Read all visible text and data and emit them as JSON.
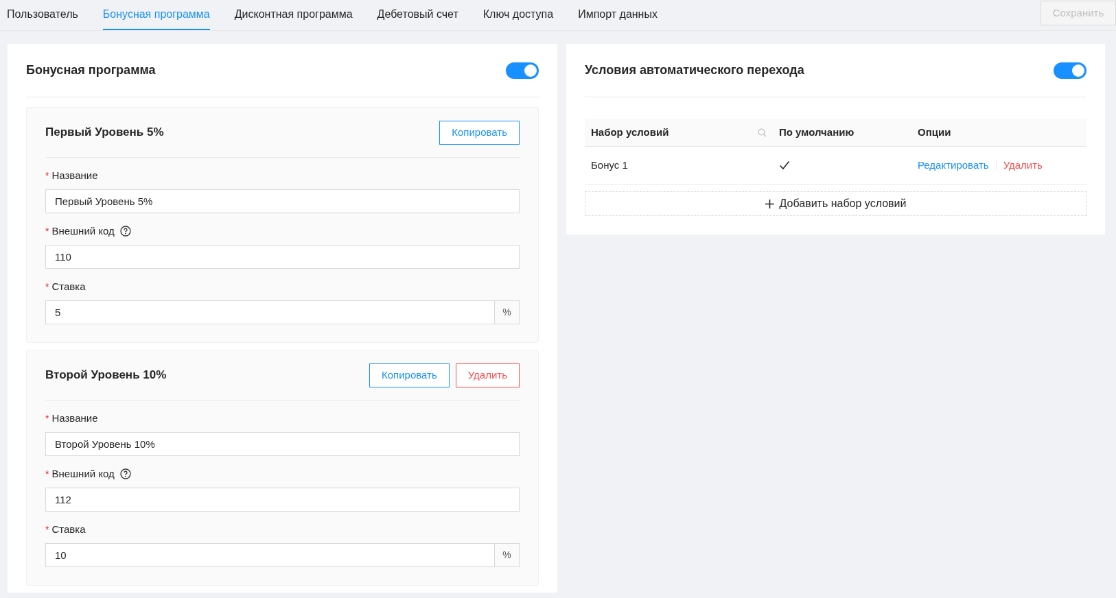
{
  "tabs": [
    {
      "label": "Пользователь",
      "selected": false
    },
    {
      "label": "Бонусная программа",
      "selected": true
    },
    {
      "label": "Дисконтная программа",
      "selected": false
    },
    {
      "label": "Дебетовый счет",
      "selected": false
    },
    {
      "label": "Ключ доступа",
      "selected": false
    },
    {
      "label": "Импорт данных",
      "selected": false
    }
  ],
  "save_button": {
    "label": "Сохранить",
    "disabled": true
  },
  "bonus_panel": {
    "title": "Бонусная программа",
    "on": true,
    "levels": [
      {
        "title": "Первый Уровень 5%",
        "buttons": [
          {
            "kind": "copy",
            "label": "Копировать"
          }
        ],
        "fields": [
          {
            "mark": "*",
            "label": "Название",
            "value": "Первый Уровень 5%",
            "help": false
          },
          {
            "mark": "*",
            "label": "Внешний код",
            "value": "110",
            "help": true
          },
          {
            "mark": "*",
            "label": "Ставка",
            "value": "5",
            "suffix": "%",
            "help": false
          }
        ]
      },
      {
        "title": "Второй Уровень 10%",
        "buttons": [
          {
            "kind": "copy",
            "label": "Копировать"
          },
          {
            "kind": "delete",
            "label": "Удалить"
          }
        ],
        "fields": [
          {
            "mark": "*",
            "label": "Название",
            "value": "Второй Уровень 10%",
            "help": false
          },
          {
            "mark": "*",
            "label": "Внешний код",
            "value": "112",
            "help": true
          },
          {
            "mark": "*",
            "label": "Ставка",
            "value": "10",
            "suffix": "%",
            "help": false
          }
        ]
      }
    ]
  },
  "transition_panel": {
    "title": "Условия автоматического перехода",
    "on": true,
    "table": {
      "columns": [
        {
          "label": "Набор условий",
          "searchable": true
        },
        {
          "label": "По умолчанию",
          "searchable": false
        },
        {
          "label": "Опции",
          "searchable": false
        }
      ],
      "rows": [
        {
          "name": "Бонус 1",
          "default": true,
          "actions": [
            {
              "kind": "edit",
              "label": "Редактировать"
            },
            {
              "kind": "delete",
              "label": "Удалить"
            }
          ]
        }
      ]
    },
    "add_button": {
      "label": "Добавить набор условий"
    }
  }
}
